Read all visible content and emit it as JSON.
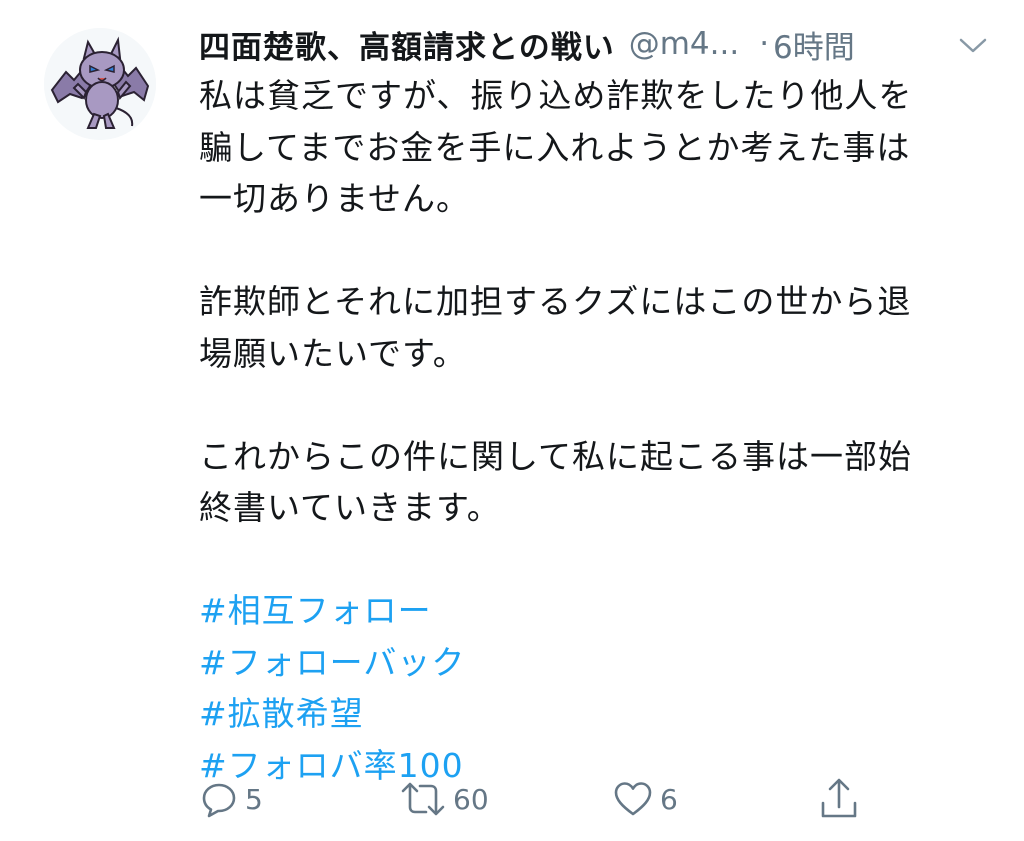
{
  "tweet": {
    "display_name": "四面楚歌、高額請求との戦い",
    "handle": "@m4...",
    "separator": "·",
    "time": "6時間",
    "lines": [
      "私は貧乏ですが、振り込め詐欺をしたり他人を",
      "騙してまでお金を手に入れようとか考えた事は",
      "一切ありません。",
      "",
      "詐欺師とそれに加担するクズにはこの世から退",
      "場願いたいです。",
      "",
      "これからこの件に関して私に起こる事は一部始",
      "終書いていきます。",
      ""
    ],
    "hashtags": [
      "#相互フォロー",
      "#フォローバック",
      "#拡散希望",
      "#フォロバ率100"
    ]
  },
  "actions": {
    "reply": {
      "icon": "reply-icon",
      "count": "5"
    },
    "retweet": {
      "icon": "retweet-icon",
      "count": "60"
    },
    "like": {
      "icon": "heart-icon",
      "count": "6"
    },
    "share": {
      "icon": "share-icon"
    }
  },
  "colors": {
    "text": "#14171a",
    "secondary": "#657786",
    "link": "#1da1f2",
    "avatar_creature": "#8a7ba8"
  }
}
